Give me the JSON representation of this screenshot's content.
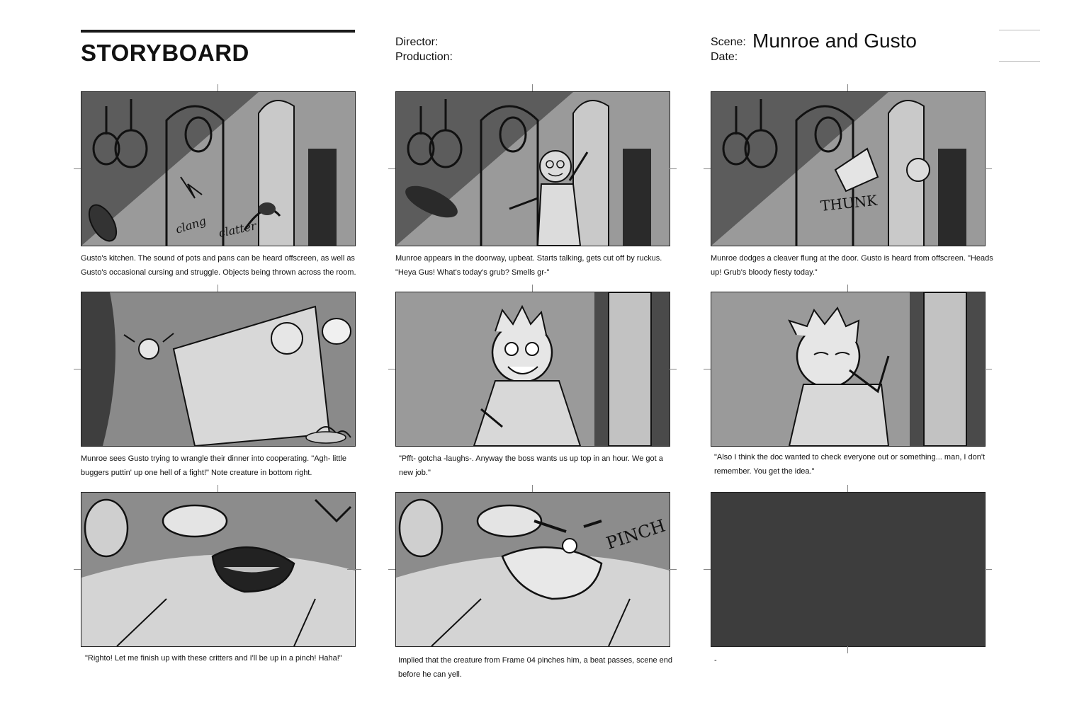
{
  "header": {
    "title": "STORYBOARD",
    "director_label": "Director:",
    "production_label": "Production:",
    "scene_label": "Scene:",
    "date_label": "Date:",
    "scene_title": "Munroe and Gusto"
  },
  "frames": [
    {
      "caption": "Gusto's kitchen. The sound of pots and pans can be heard offscreen, as well as Gusto's occasional cursing and struggle. Objects being thrown across the room.",
      "sfx": [
        "clang",
        "clatter"
      ]
    },
    {
      "caption": "Munroe appears in the doorway, upbeat. Starts talking, gets cut off by ruckus. \"Heya Gus! What's today's grub? Smells gr-\"",
      "sfx": []
    },
    {
      "caption": "Munroe dodges a cleaver flung at the door. Gusto is heard from offscreen. \"Heads up! Grub's bloody fiesty today.\"",
      "sfx": [
        "THUNK"
      ]
    },
    {
      "caption": "Munroe sees Gusto trying to wrangle their dinner into cooperating. \"Agh- little buggers puttin' up one hell of a fight!\" Note creature in bottom right.",
      "sfx": []
    },
    {
      "caption": "\"Pfft- gotcha -laughs-. Anyway the boss wants us up top in an hour. We got a new job.\"",
      "sfx": []
    },
    {
      "caption": "\"Also I think the doc wanted to check everyone out or something... man, I don't remember. You get the idea.\"",
      "sfx": []
    },
    {
      "caption": "\"Righto! Let me finish up with these critters and I'll be up in a pinch! Haha!\"",
      "sfx": []
    },
    {
      "caption": "Implied that the creature from Frame 04 pinches him, a beat passes, scene end before he can yell.",
      "sfx": [
        "PINCH"
      ]
    },
    {
      "caption": "-",
      "sfx": []
    }
  ]
}
